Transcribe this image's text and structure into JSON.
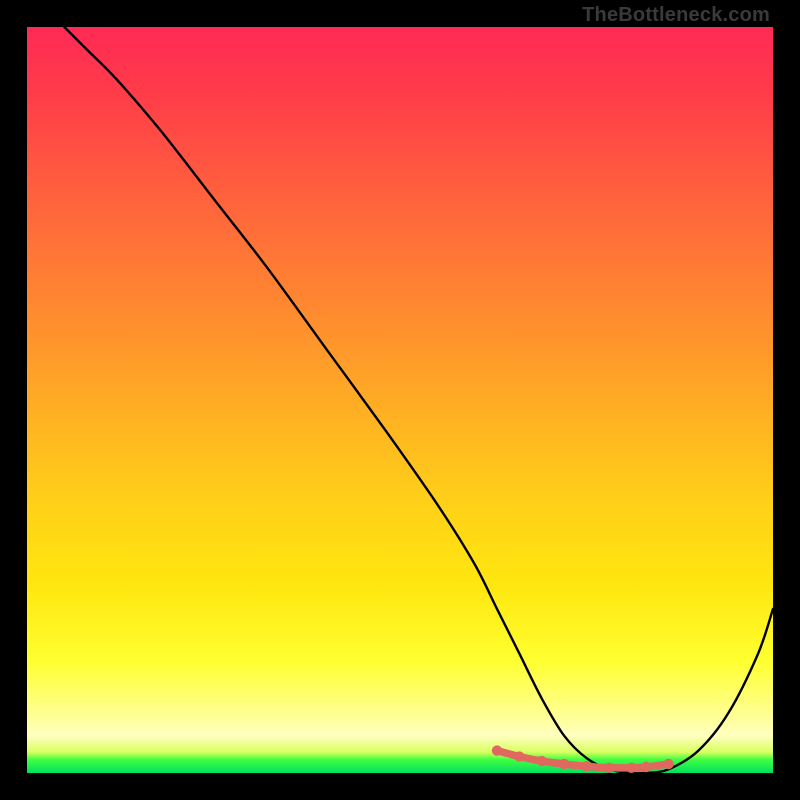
{
  "attribution": "TheBottleneck.com",
  "chart_data": {
    "type": "line",
    "title": "",
    "xlabel": "",
    "ylabel": "",
    "xlim": [
      0,
      100
    ],
    "ylim": [
      0,
      100
    ],
    "series": [
      {
        "name": "bottleneck-curve",
        "x": [
          5,
          8,
          12,
          18,
          25,
          32,
          40,
          48,
          55,
          60,
          63,
          66,
          69,
          72,
          75,
          78,
          81,
          83,
          86,
          90,
          94,
          98,
          100
        ],
        "y": [
          100,
          97,
          93,
          86,
          77,
          68,
          57,
          46,
          36,
          28,
          22,
          16,
          10,
          5,
          2,
          0.5,
          0,
          0,
          0.5,
          3,
          8,
          16,
          22
        ]
      }
    ],
    "highlight": {
      "name": "optimal-range",
      "x": [
        63,
        66,
        69,
        72,
        75,
        78,
        81,
        83,
        86
      ],
      "y": [
        3,
        2.2,
        1.6,
        1.2,
        0.9,
        0.7,
        0.7,
        0.8,
        1.2
      ]
    },
    "gradient_stops": [
      {
        "pos": 0,
        "color": "#ff2a55"
      },
      {
        "pos": 50,
        "color": "#ffb920"
      },
      {
        "pos": 85,
        "color": "#ffff30"
      },
      {
        "pos": 100,
        "color": "#00e060"
      }
    ]
  }
}
